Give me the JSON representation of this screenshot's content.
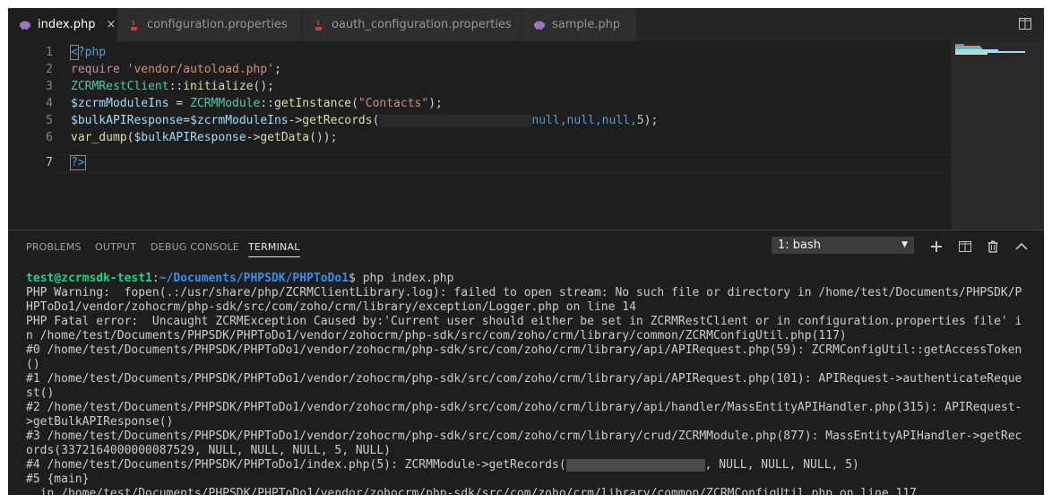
{
  "tabs": [
    {
      "label": "index.php",
      "icon": "php-elephant-icon",
      "active": true,
      "close": "×"
    },
    {
      "label": "configuration.properties",
      "icon": "java-icon"
    },
    {
      "label": "oauth_configuration.properties",
      "icon": "java-icon"
    },
    {
      "label": "sample.php",
      "icon": "php-elephant-icon"
    }
  ],
  "editor": {
    "line_numbers": [
      "1",
      "2",
      "3",
      "4",
      "5",
      "6",
      "7"
    ],
    "lines": [
      {
        "a": "<",
        "b": "?php"
      },
      {
        "a": "require",
        "b": "'vendor/autoload.php'",
        "c": ";"
      },
      {
        "a": "ZCRMRestClient",
        "b": "::",
        "c": "initialize",
        "d": "();"
      },
      {
        "a": "$zcrmModuleIns",
        "b": " = ",
        "c": "ZCRMModule",
        "d": "::",
        "e": "getInstance",
        "f": "(",
        "g": "\"Contacts\"",
        "h": ");"
      },
      {
        "a": "$bulkAPIResponse",
        "b": "=",
        "c": "$zcrmModuleIns",
        "d": "->",
        "e": "getRecords",
        "f": "(",
        "g": "null,null,null,",
        "h": "5",
        "i": ");"
      },
      {
        "a": "var_dump",
        "b": "(",
        "c": "$bulkAPIResponse",
        "d": "->",
        "e": "getData",
        "f": "());"
      },
      {
        "a": "?>"
      }
    ]
  },
  "panel": {
    "tabs": [
      "PROBLEMS",
      "OUTPUT",
      "DEBUG CONSOLE",
      "TERMINAL"
    ],
    "terminal_select": "1: bash",
    "prompt": {
      "user": "test@zcrmsdk-test1",
      "sep": ":",
      "path": "~/Documents/PHPSDK/PHPToDo1",
      "cmd": "$ php index.php"
    },
    "output": [
      "PHP Warning:  fopen(.:/usr/share/php/ZCRMClientLibrary.log): failed to open stream: No such file or directory in /home/test/Documents/PHPSDK/P",
      "HPToDo1/vendor/zohocrm/php-sdk/src/com/zoho/crm/library/exception/Logger.php on line 14",
      "PHP Fatal error:  Uncaught ZCRMException Caused by:'Current user should either be set in ZCRMRestClient or in configuration.properties file' i",
      "n /home/test/Documents/PHPSDK/PHPToDo1/vendor/zohocrm/php-sdk/src/com/zoho/crm/library/common/ZCRMConfigUtil.php(117)",
      "#0 /home/test/Documents/PHPSDK/PHPToDo1/vendor/zohocrm/php-sdk/src/com/zoho/crm/library/api/APIRequest.php(59): ZCRMConfigUtil::getAccessToken",
      "()",
      "#1 /home/test/Documents/PHPSDK/PHPToDo1/vendor/zohocrm/php-sdk/src/com/zoho/crm/library/api/APIRequest.php(101): APIRequest->authenticateReque",
      "st()",
      "#2 /home/test/Documents/PHPSDK/PHPToDo1/vendor/zohocrm/php-sdk/src/com/zoho/crm/library/api/handler/MassEntityAPIHandler.php(315): APIRequest-",
      ">getBulkAPIResponse()",
      "#3 /home/test/Documents/PHPSDK/PHPToDo1/vendor/zohocrm/php-sdk/src/com/zoho/crm/library/crud/ZCRMModule.php(877): MassEntityAPIHandler->getRec",
      "ords(3372164000000087529, NULL, NULL, NULL, 5, NULL)"
    ],
    "line4_a": "#4 /home/test/Documents/PHPSDK/PHPToDo1/index.php(5): ZCRMModule->getRecords(",
    "line4_b": ", NULL, NULL, NULL, 5)",
    "line5": "#5 {main}",
    "line6": "  in /home/test/Documents/PHPSDK/PHPToDo1/vendor/zohocrm/php-sdk/src/com/zoho/crm/library/common/ZCRMConfigUtil.php on line 117"
  }
}
